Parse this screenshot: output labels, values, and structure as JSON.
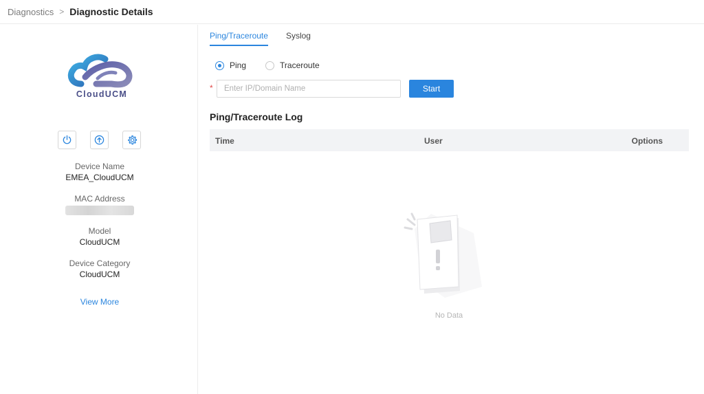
{
  "breadcrumb": {
    "parent": "Diagnostics",
    "separator": ">",
    "current": "Diagnostic Details"
  },
  "device": {
    "logo_text": "CloudUCM",
    "actions": [
      {
        "icon": "power-icon"
      },
      {
        "icon": "upload-icon"
      },
      {
        "icon": "gear-icon"
      }
    ],
    "fields": [
      {
        "label": "Device Name",
        "value": "EMEA_CloudUCM"
      },
      {
        "label": "MAC Address",
        "value": ""
      },
      {
        "label": "Model",
        "value": "CloudUCM"
      },
      {
        "label": "Device Category",
        "value": "CloudUCM"
      }
    ],
    "view_more": "View More"
  },
  "tabs": [
    {
      "label": "Ping/Traceroute",
      "active": true
    },
    {
      "label": "Syslog",
      "active": false
    }
  ],
  "form": {
    "mode_options": [
      {
        "label": "Ping",
        "checked": true
      },
      {
        "label": "Traceroute",
        "checked": false
      }
    ],
    "required_mark": "*",
    "ip_placeholder": "Enter IP/Domain Name",
    "ip_value": "",
    "start_label": "Start"
  },
  "log": {
    "title": "Ping/Traceroute Log",
    "columns": [
      "Time",
      "User",
      "Options"
    ],
    "rows": [],
    "empty_text": "No Data"
  },
  "colors": {
    "accent": "#2a85de",
    "required": "#e04848",
    "table_header_bg": "#f2f3f5"
  }
}
